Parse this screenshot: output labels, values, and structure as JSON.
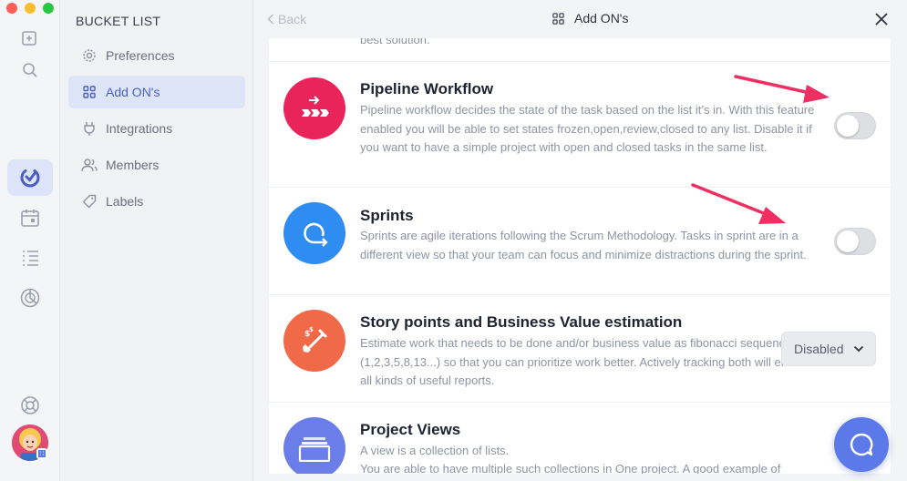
{
  "sidebar": {
    "title": "BUCKET LIST",
    "items": [
      {
        "label": "Preferences"
      },
      {
        "label": "Add ON's"
      },
      {
        "label": "Integrations"
      },
      {
        "label": "Members"
      },
      {
        "label": "Labels"
      }
    ]
  },
  "header": {
    "back_label": "Back",
    "title": "Add ON's"
  },
  "content": {
    "cut_text": "best solution.",
    "addons": [
      {
        "title": "Pipeline Workflow",
        "description": "Pipeline workflow decides the state of the task based on the list it’s in. With this feature enabled you will be able to set states frozen,open,review,closed to any list. Disable it if you want to have a simple project with open and closed tasks in the same list.",
        "enabled": false
      },
      {
        "title": "Sprints",
        "description": "Sprints are agile iterations following the Scrum Methodology. Tasks in sprint are in a different view so that your team can focus and minimize distractions during the sprint.",
        "enabled": false
      },
      {
        "title": "Story points and Business Value estimation",
        "description": "Estimate work that needs to be done and/or business value as fibonacci sequence (1,2,3,5,8,13...) so that you can prioritize work better. Actively tracking both will enable all kinds of useful reports.",
        "control_value": "Disabled"
      },
      {
        "title": "Project Views",
        "description": "A view is a collection of lists.",
        "description2": "You are able to have multiple such collections in One project. A good example of"
      }
    ]
  },
  "colors": {
    "accent": "#4a5fc1",
    "pipeline_icon": "#e8245a",
    "sprints_icon": "#2f8cf0",
    "story_icon": "#f06a4a",
    "views_icon": "#6b7de8",
    "annotation_arrow": "#ee2f62",
    "chat_button": "#5b79e8"
  },
  "icons": {
    "rail": [
      "add-task-icon",
      "search-icon",
      "project-logo-icon",
      "calendar-icon",
      "list-icon",
      "reports-icon",
      "help-icon"
    ],
    "chat": "chat-icon"
  }
}
